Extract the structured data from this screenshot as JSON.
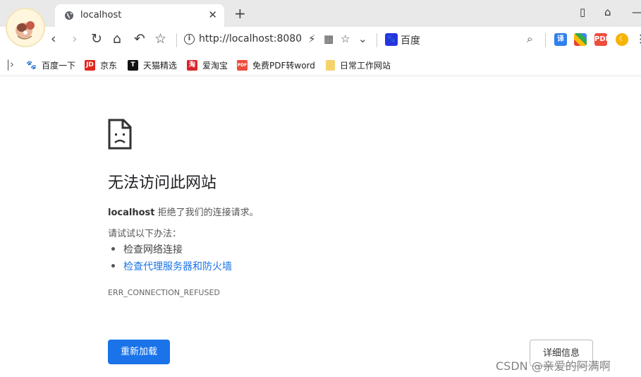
{
  "tab": {
    "title": "localhost",
    "globe_icon": "globe-icon",
    "close_icon": "close-icon",
    "new_tab_icon": "plus-icon"
  },
  "window_controls": {
    "icon1": "tablet-icon",
    "icon2": "shirt-icon",
    "icon3": "minimize-icon"
  },
  "address_bar": {
    "url": "http://localhost:8080",
    "search_engine": "百度"
  },
  "bookmarks": [
    {
      "label": "百度一下",
      "icon": "baidu-paw-icon",
      "color": "#2932e1"
    },
    {
      "label": "京东",
      "icon": "jd-icon",
      "icon_text": "JD",
      "color": "#e1251b"
    },
    {
      "label": "天猫精选",
      "icon": "tmall-icon",
      "icon_text": "T",
      "color": "#111111"
    },
    {
      "label": "爱淘宝",
      "icon": "taobao-icon",
      "icon_text": "淘",
      "color": "#d8262c"
    },
    {
      "label": "免费PDF转word",
      "icon": "pdf-icon",
      "icon_text": "PDF",
      "color": "#ee4d3c"
    },
    {
      "label": "日常工作网站",
      "icon": "folder-icon",
      "color": "#f5d36b"
    }
  ],
  "error_page": {
    "heading": "无法访问此网站",
    "host": "localhost",
    "message": "拒绝了我们的连接请求。",
    "try_label": "请试试以下办法：",
    "suggestions": [
      "检查网络连接",
      "检查代理服务器和防火墙"
    ],
    "error_code": "ERR_CONNECTION_REFUSED",
    "reload_label": "重新加载",
    "details_label": "详细信息"
  },
  "watermark": "CSDN @亲爱的阿满啊",
  "colors": {
    "accent": "#1a73e8",
    "link": "#1a73e8"
  }
}
